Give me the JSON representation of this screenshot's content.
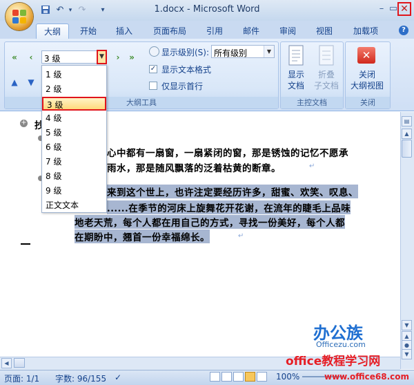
{
  "window": {
    "title": "1.docx - Microsoft Word",
    "close": "✕",
    "minimize": "–",
    "restore": "▭"
  },
  "qat": {
    "save_icon": "save-icon",
    "undo": "↶",
    "redo": "↷",
    "customize": "▾"
  },
  "tabs": [
    "大纲",
    "开始",
    "插入",
    "页面布局",
    "引用",
    "邮件",
    "审阅",
    "视图",
    "加载项"
  ],
  "active_tab": "大纲",
  "help": "?",
  "outline_group": {
    "label": "大纲工具",
    "level_value": "3 级",
    "show_level_label": "显示级别(S):",
    "show_level_value": "所有级别",
    "show_format_label": "显示文本格式",
    "show_format_checked": true,
    "first_line_label": "仅显示首行",
    "first_line_checked": false
  },
  "master_group": {
    "label": "主控文档",
    "show_doc_line1": "显示",
    "show_doc_line2": "文档",
    "collapse_line1": "折叠",
    "collapse_line2": "子文档"
  },
  "close_group": {
    "label": "关闭",
    "line1": "关闭",
    "line2": "大纲视图"
  },
  "dropdown": {
    "items": [
      "1 级",
      "2 级",
      "3 级",
      "4 级",
      "5 级",
      "6 级",
      "7 级",
      "8 级",
      "9 级",
      "正文文本"
    ],
    "selected": "3 级"
  },
  "document": {
    "heading_fragment": "抄",
    "line1": "心中都有一扇窗，一扇紧闭的窗，那是锈蚀的记忆不愿承",
    "line2": "雨水，那是随风飘落的泛着枯黄的断章。",
    "line3": "来到这个世上，也许注定要经历许多，甜蜜、欢笑、叹息、",
    "line4": "......在季节的河床上旋舞花开花谢，在流年的睫毛上品味",
    "line5": "地老天荒，每个人都在用自己的方式，寻找一份美好，每个人都",
    "line6": "在期盼中，翘首一份幸福绵长。",
    "para_mark": "↵"
  },
  "status": {
    "page": "页面: 1/1",
    "words": "字数: 96/155",
    "zoom": "100%"
  },
  "watermark": {
    "brand": "办公族",
    "brand_sub": "Officezu.com",
    "site_cn": "office教程学习网",
    "site_url": "www.office68.com"
  },
  "colors": {
    "accent_red": "#e0141b",
    "ribbon_blue": "#15428b",
    "selection": "#a7b6d1"
  }
}
